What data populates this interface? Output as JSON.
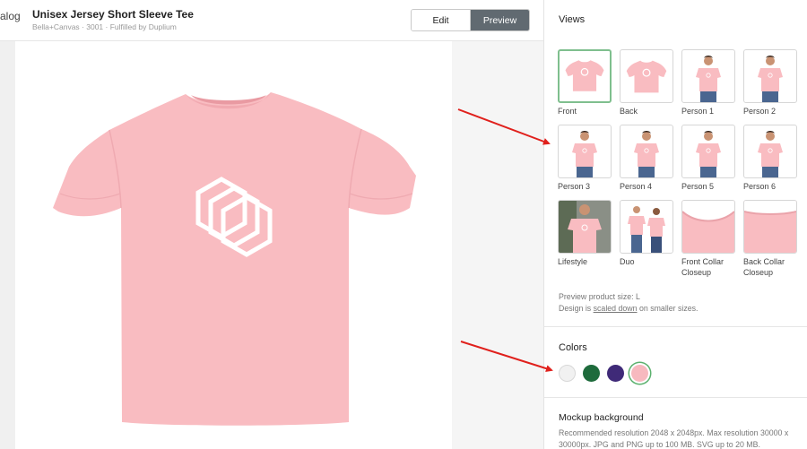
{
  "header": {
    "back_label": "alog",
    "title": "Unisex Jersey Short Sleeve Tee",
    "subtitle": "Bella+Canvas · 3001 · Fulfilled by Duplium",
    "edit_label": "Edit",
    "preview_label": "Preview"
  },
  "preview": {
    "shirt_color": "#f9bcc1",
    "logo_color": "#ffffff"
  },
  "views": {
    "title": "Views",
    "items": [
      {
        "label": "Front",
        "kind": "front",
        "selected": true
      },
      {
        "label": "Back",
        "kind": "back",
        "selected": false
      },
      {
        "label": "Person 1",
        "kind": "person",
        "selected": false
      },
      {
        "label": "Person 2",
        "kind": "person",
        "selected": false
      },
      {
        "label": "Person 3",
        "kind": "person",
        "selected": false
      },
      {
        "label": "Person 4",
        "kind": "person",
        "selected": false
      },
      {
        "label": "Person 5",
        "kind": "person",
        "selected": false
      },
      {
        "label": "Person 6",
        "kind": "person",
        "selected": false
      },
      {
        "label": "Lifestyle",
        "kind": "lifestyle",
        "selected": false
      },
      {
        "label": "Duo",
        "kind": "duo",
        "selected": false
      },
      {
        "label": "Front Collar Closeup",
        "kind": "collar",
        "selected": false
      },
      {
        "label": "Back Collar Closeup",
        "kind": "collar-back",
        "selected": false
      }
    ],
    "note_size": "Preview product size: L",
    "note_scale_prefix": "Design is ",
    "note_scale_link": "scaled down",
    "note_scale_suffix": " on smaller sizes."
  },
  "colors": {
    "title": "Colors",
    "swatches": [
      {
        "name": "white",
        "hex": "#f1f1f1",
        "selected": false
      },
      {
        "name": "green",
        "hex": "#1e6b3c",
        "selected": false
      },
      {
        "name": "purple",
        "hex": "#3f2a78",
        "selected": false
      },
      {
        "name": "pink",
        "hex": "#f7b9bf",
        "selected": true
      }
    ]
  },
  "mockup_background": {
    "title": "Mockup background",
    "description": "Recommended resolution 2048 x 2048px. Max resolution 30000 x 30000px. JPG and PNG up to 100 MB. SVG up to 20 MB."
  },
  "accent_colors": {
    "annotation_arrow": "#e0201c",
    "selected_border": "#7fbf8e",
    "preview_button": "#616a71"
  }
}
